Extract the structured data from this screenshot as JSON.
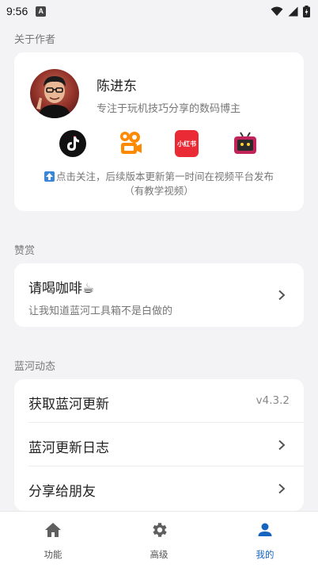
{
  "status_bar": {
    "time": "9:56",
    "notification_badge": "A"
  },
  "sections": {
    "about_author": "关于作者",
    "appreciation": "赞赏",
    "updates": "蓝河动态"
  },
  "author": {
    "name": "陈进东",
    "description": "专注于玩机技巧分享的数码博主",
    "socials": [
      {
        "name": "douyin-icon"
      },
      {
        "name": "kuaishou-icon"
      },
      {
        "name": "xiaohongshu-icon",
        "label": "小红书"
      },
      {
        "name": "bilibili-icon"
      }
    ],
    "follow_text_line1": "点击关注，后续版本更新第一时间在视频平台发布",
    "follow_text_line2": "（有教学视频）"
  },
  "coffee": {
    "title": "请喝咖啡☕",
    "subtitle": "让我知道蓝河工具箱不是白做的"
  },
  "updates": {
    "rows": [
      {
        "label": "获取蓝河更新",
        "value": "v4.3.2"
      },
      {
        "label": "蓝河更新日志"
      },
      {
        "label": "分享给朋友"
      }
    ]
  },
  "nav": {
    "items": [
      {
        "label": "功能"
      },
      {
        "label": "高级"
      },
      {
        "label": "我的"
      }
    ],
    "active_index": 2,
    "active_color": "#1565c0"
  }
}
